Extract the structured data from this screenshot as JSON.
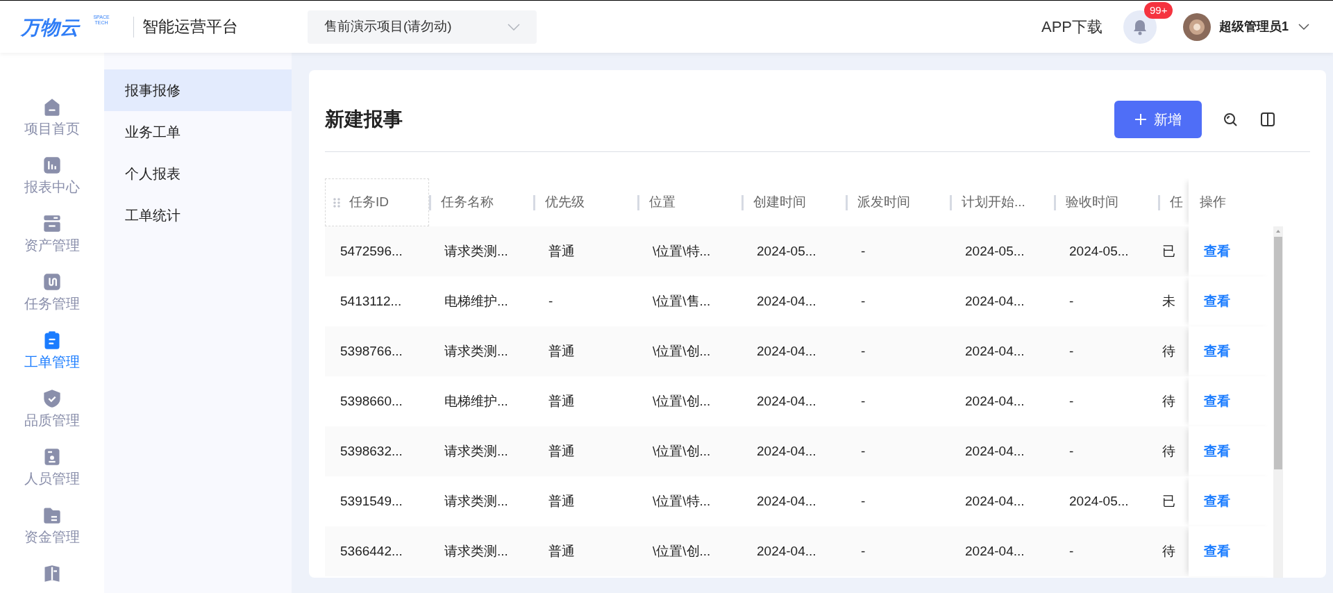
{
  "header": {
    "logo": "万物云",
    "logo_sub": "SPACE TECH",
    "platform": "智能运营平台",
    "project": "售前演示项目(请勿动)",
    "app_download": "APP下载",
    "notification_count": "99+",
    "user": "超级管理员1"
  },
  "nav": [
    {
      "label": "项目首页",
      "selected": false
    },
    {
      "label": "报表中心",
      "selected": false
    },
    {
      "label": "资产管理",
      "selected": false
    },
    {
      "label": "任务管理",
      "selected": false
    },
    {
      "label": "工单管理",
      "selected": true
    },
    {
      "label": "品质管理",
      "selected": false
    },
    {
      "label": "人员管理",
      "selected": false
    },
    {
      "label": "资金管理",
      "selected": false
    },
    {
      "selected": false
    }
  ],
  "submenu": [
    {
      "label": "报事报修",
      "selected": true
    },
    {
      "label": "业务工单",
      "selected": false
    },
    {
      "label": "个人报表",
      "selected": false
    },
    {
      "label": "工单统计",
      "selected": false
    }
  ],
  "page": {
    "title": "新建报事",
    "add_button": "新增"
  },
  "table": {
    "columns": [
      "任务ID",
      "任务名称",
      "优先级",
      "位置",
      "创建时间",
      "派发时间",
      "计划开始...",
      "验收时间",
      "任"
    ],
    "action_column": "操作",
    "rows": [
      {
        "cells": [
          "5472596...",
          "请求类测...",
          "普通",
          "\\位置\\特...",
          "2024-05...",
          "-",
          "2024-05...",
          "2024-05...",
          "已"
        ],
        "action": "查看"
      },
      {
        "cells": [
          "5413112...",
          "电梯维护...",
          "-",
          "\\位置\\售...",
          "2024-04...",
          "-",
          "2024-04...",
          "-",
          "未"
        ],
        "action": "查看"
      },
      {
        "cells": [
          "5398766...",
          "请求类测...",
          "普通",
          "\\位置\\创...",
          "2024-04...",
          "-",
          "2024-04...",
          "-",
          "待"
        ],
        "action": "查看"
      },
      {
        "cells": [
          "5398660...",
          "电梯维护...",
          "普通",
          "\\位置\\创...",
          "2024-04...",
          "-",
          "2024-04...",
          "-",
          "待"
        ],
        "action": "查看"
      },
      {
        "cells": [
          "5398632...",
          "请求类测...",
          "普通",
          "\\位置\\创...",
          "2024-04...",
          "-",
          "2024-04...",
          "-",
          "待"
        ],
        "action": "查看"
      },
      {
        "cells": [
          "5391549...",
          "请求类测...",
          "普通",
          "\\位置\\特...",
          "2024-04...",
          "-",
          "2024-04...",
          "2024-05...",
          "已"
        ],
        "action": "查看"
      },
      {
        "cells": [
          "5366442...",
          "请求类测...",
          "普通",
          "\\位置\\创...",
          "2024-04...",
          "-",
          "2024-04...",
          "-",
          "待"
        ],
        "action": "查看"
      }
    ]
  }
}
